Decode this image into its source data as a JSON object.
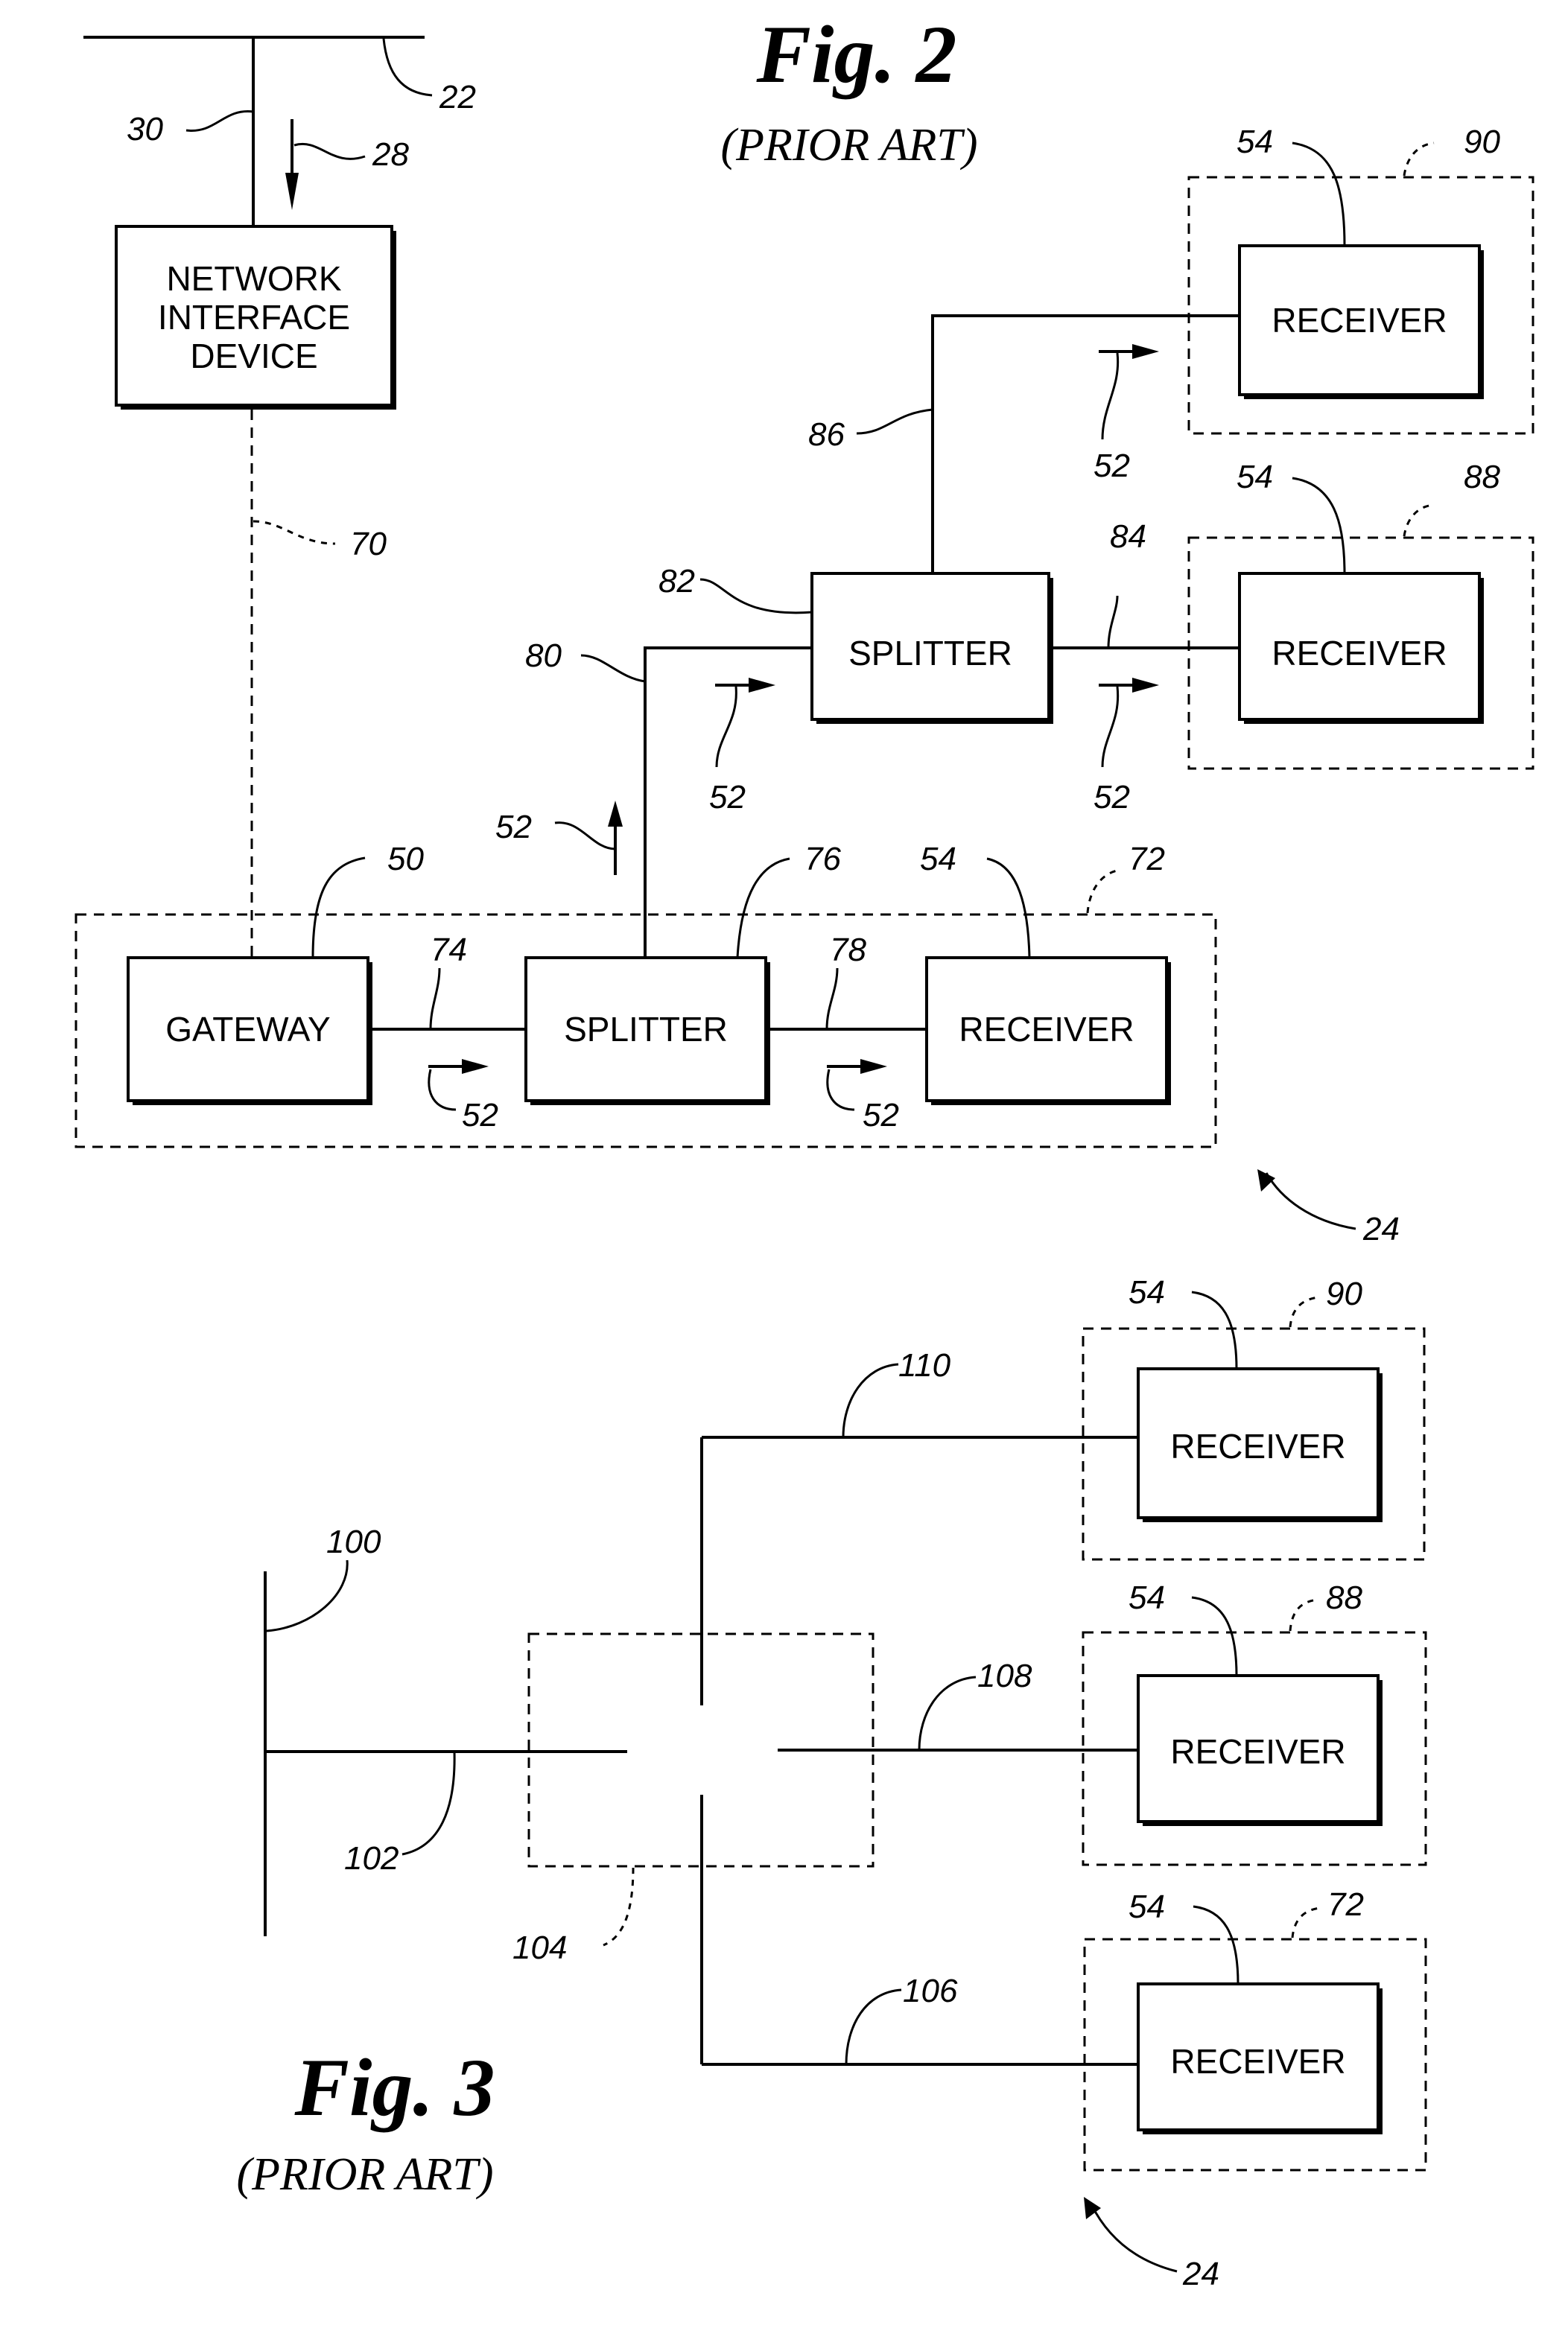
{
  "figures": [
    {
      "id": "fig2",
      "title": "Fig. 2",
      "subtitle": "(PRIOR ART)",
      "blocks": {
        "nid": [
          "NETWORK",
          "INTERFACE",
          "DEVICE"
        ],
        "gateway": "GATEWAY",
        "splitter_main": "SPLITTER",
        "receiver_main": "RECEIVER",
        "splitter_upper": "SPLITTER",
        "receiver_top": "RECEIVER",
        "receiver_mid": "RECEIVER"
      },
      "refs": {
        "r22": "22",
        "r30": "30",
        "r28": "28",
        "r70": "70",
        "r50": "50",
        "r74": "74",
        "r76": "76",
        "r78": "78",
        "r54_main": "54",
        "r72": "72",
        "r52_a": "52",
        "r52_b": "52",
        "r52_up": "52",
        "r80": "80",
        "r82": "82",
        "r52_c": "52",
        "r84": "84",
        "r52_d": "52",
        "r86": "86",
        "r52_e": "52",
        "r54_top": "54",
        "r90": "90",
        "r54_mid": "54",
        "r88": "88",
        "r24": "24"
      }
    },
    {
      "id": "fig3",
      "title": "Fig. 3",
      "subtitle": "(PRIOR ART)",
      "blocks": {
        "receiver_top": "RECEIVER",
        "receiver_mid": "RECEIVER",
        "receiver_bot": "RECEIVER"
      },
      "refs": {
        "r100": "100",
        "r102": "102",
        "r104": "104",
        "r110": "110",
        "r108": "108",
        "r106": "106",
        "r54_top": "54",
        "r90": "90",
        "r54_mid": "54",
        "r88": "88",
        "r54_bot": "54",
        "r72": "72",
        "r24": "24"
      }
    }
  ]
}
